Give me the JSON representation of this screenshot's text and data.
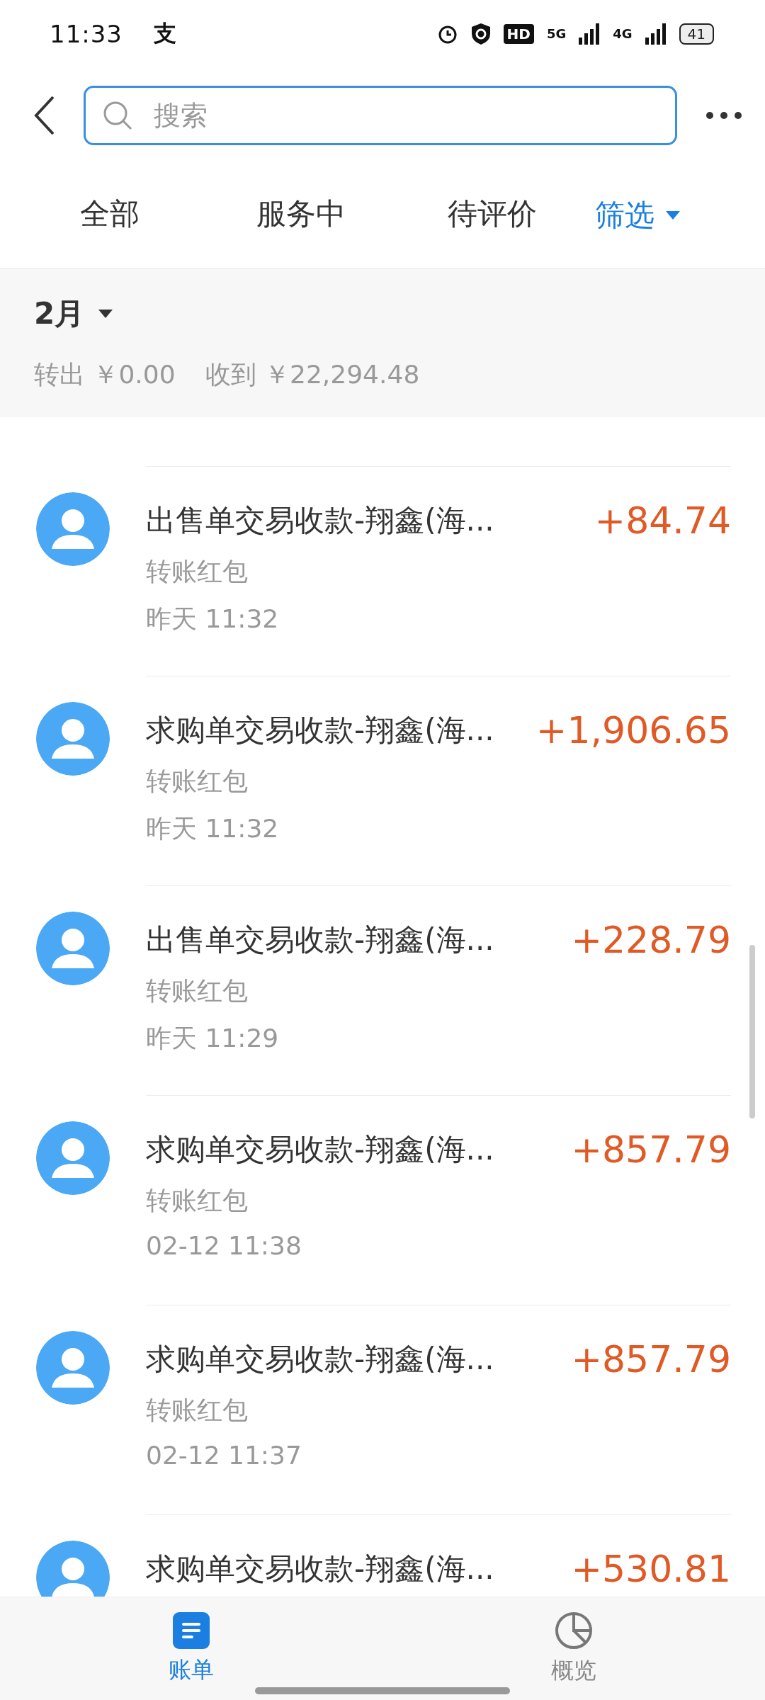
{
  "status_bar": {
    "time": "11:33",
    "app_glyph": "支",
    "hd": "HD",
    "networks": [
      "5G",
      "4G"
    ],
    "battery": "41"
  },
  "header": {
    "search": {
      "placeholder": "搜索"
    }
  },
  "tabs": [
    {
      "label": "全部",
      "selected": false
    },
    {
      "label": "服务中",
      "selected": false
    },
    {
      "label": "待评价",
      "selected": false
    }
  ],
  "filter": {
    "label": "筛选"
  },
  "month": {
    "label": "2月",
    "summary": [
      {
        "label": "转出",
        "amount": "￥0.00"
      },
      {
        "label": "收到",
        "amount": "￥22,294.48"
      }
    ]
  },
  "transactions": [
    {
      "title": "出售单交易收款-翔鑫(海...",
      "subtitle": "转账红包",
      "time": "昨天  11:32",
      "amount": "+84.74"
    },
    {
      "title": "求购单交易收款-翔鑫(海...",
      "subtitle": "转账红包",
      "time": "昨天  11:32",
      "amount": "+1,906.65"
    },
    {
      "title": "出售单交易收款-翔鑫(海...",
      "subtitle": "转账红包",
      "time": "昨天  11:29",
      "amount": "+228.79"
    },
    {
      "title": "求购单交易收款-翔鑫(海...",
      "subtitle": "转账红包",
      "time": "02-12  11:38",
      "amount": "+857.79"
    },
    {
      "title": "求购单交易收款-翔鑫(海...",
      "subtitle": "转账红包",
      "time": "02-12  11:37",
      "amount": "+857.79"
    },
    {
      "title": "求购单交易收款-翔鑫(海...",
      "amount": "+530.81"
    }
  ],
  "bottom_nav": [
    {
      "label": "账单",
      "kind": "bill",
      "selected": true
    },
    {
      "label": "概览",
      "kind": "overview",
      "selected": false
    }
  ]
}
